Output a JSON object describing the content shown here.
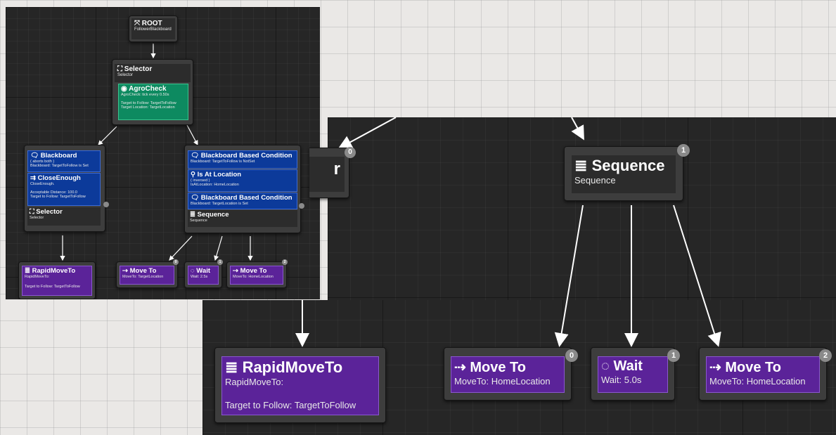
{
  "small_graph": {
    "root": {
      "title": "ROOT",
      "subtitle": "FollowerBlackboard"
    },
    "selector_top": {
      "title": "Selector",
      "subtitle": "Selector"
    },
    "agro": {
      "title": "AgroCheck",
      "line1": "AgroCheck: tick every 0.50s",
      "line2": "Target to Follow: TargetToFollow",
      "line3": "Target Location: TargetLocation"
    },
    "left_blackboard": {
      "title": "Blackboard",
      "line1": "( aborts both )",
      "line2": "Blackboard: TargetToFollow is Set"
    },
    "close_enough": {
      "title": "CloseEnough",
      "line1": "CloseEnough.",
      "line2": "Acceptable Distance: 100.0",
      "line3": "Target to Follow: TargetToFollow"
    },
    "selector_left": {
      "title": "Selector",
      "subtitle": "Selector"
    },
    "bb_cond1": {
      "title": "Blackboard Based Condition",
      "line1": "Blackboard: TargetToFollow is NotSet"
    },
    "at_location": {
      "title": "Is At Location",
      "line1": "( inversed )",
      "line2": "IsAtLocation: HomeLocation"
    },
    "bb_cond2": {
      "title": "Blackboard Based Condition",
      "line1": "Blackboard: TargetLocation is Set"
    },
    "sequence": {
      "title": "Sequence",
      "subtitle": "Sequence"
    },
    "rapid": {
      "title": "RapidMoveTo",
      "line1": "RapidMoveTo:",
      "line2": "Target to Follow: TargetToFollow"
    },
    "move1": {
      "title": "Move To",
      "line1": "MoveTo: TargetLocation",
      "index": "0"
    },
    "wait": {
      "title": "Wait",
      "line1": "Wait: 2.5s",
      "index": "1"
    },
    "move2": {
      "title": "Move To",
      "line1": "MoveTo: HomeLocation",
      "index": "2"
    }
  },
  "zoom_graph": {
    "left_fragment": {
      "title": "r",
      "index": "0"
    },
    "sequence": {
      "title": "Sequence",
      "subtitle": "Sequence",
      "index": "1"
    },
    "rapid": {
      "title": "RapidMoveTo",
      "line1": "RapidMoveTo:",
      "line2": "Target to Follow: TargetToFollow"
    },
    "move1": {
      "title": "Move To",
      "line1": "MoveTo: HomeLocation",
      "index": "0"
    },
    "wait": {
      "title": "Wait",
      "line1": "Wait: 5.0s",
      "index": "1"
    },
    "move2": {
      "title": "Move To",
      "line1": "MoveTo: HomeLocation",
      "index": "2"
    }
  },
  "icons": {
    "root": "root-icon",
    "selector": "selector-icon",
    "service": "service-eye-icon",
    "blackboard": "blackboard-icon",
    "close_enough": "decorator-icon",
    "location": "location-icon",
    "sequence": "sequence-icon",
    "rapid": "rapid-move-icon",
    "move": "move-to-icon",
    "wait": "wait-icon"
  },
  "colors": {
    "graph_bg": "#262626",
    "node_bg": "#3d3d3d",
    "task": "#5b2399",
    "decorator": "#0c3a9a",
    "service": "#0d8a60",
    "wire": "#ffffff",
    "outer_bg": "#eae8e6"
  }
}
